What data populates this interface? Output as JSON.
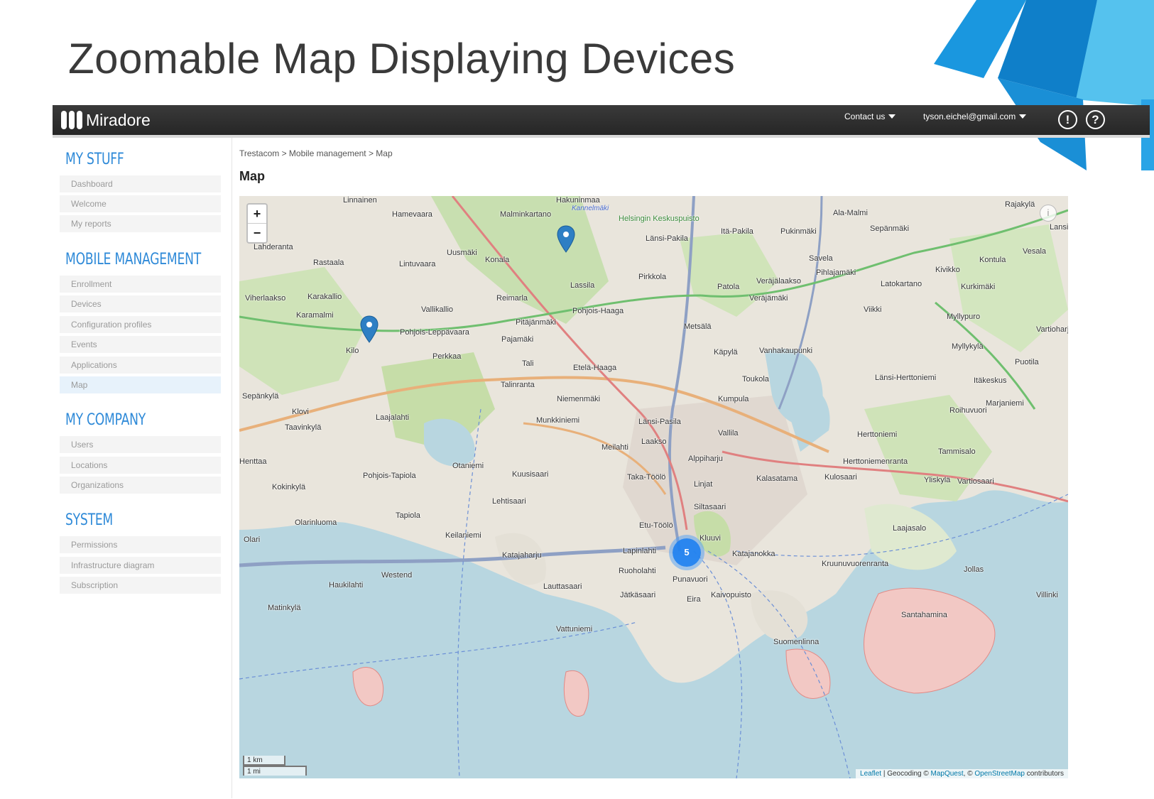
{
  "slide": {
    "title": "Zoomable Map Displaying Devices"
  },
  "topbar": {
    "logo_text": "Miradore",
    "contact_label": "Contact us",
    "user_email": "tyson.eichel@gmail.com",
    "alert_icon": "exclamation-circle-icon",
    "help_icon": "question-circle-icon"
  },
  "sidebar": {
    "sections": [
      {
        "title": "MY STUFF",
        "items": [
          "Dashboard",
          "Welcome",
          "My reports"
        ]
      },
      {
        "title": "MOBILE MANAGEMENT",
        "items": [
          "Enrollment",
          "Devices",
          "Configuration profiles",
          "Events",
          "Applications",
          "Map"
        ]
      },
      {
        "title": "MY COMPANY",
        "items": [
          "Users",
          "Locations",
          "Organizations"
        ]
      },
      {
        "title": "SYSTEM",
        "items": [
          "Permissions",
          "Infrastructure diagram",
          "Subscription"
        ]
      }
    ],
    "active_item": "Map"
  },
  "main": {
    "breadcrumb": "Trestacom > Mobile management > Map",
    "title": "Map"
  },
  "map": {
    "zoom_in": "+",
    "zoom_out": "−",
    "cluster_count": "5",
    "scale_km": "1 km",
    "scale_mi": "1 mi",
    "attribution": {
      "leaflet": "Leaflet",
      "geocoding": " | Geocoding © ",
      "mapquest": "MapQuest",
      "osm_prefix": ", © ",
      "osm": "OpenStreetMap",
      "suffix": " contributors"
    },
    "places": [
      "Linnainen",
      "Hakuninmaa",
      "Hamevaara",
      "Malminkartano",
      "Kannelmäki",
      "Ala-Malmi",
      "Rajakylä",
      "Helsingin Keskuspuisto",
      "Itä-Pakila",
      "Pukinmäki",
      "Sepänmäki",
      "Lansi",
      "Lahderanta",
      "Länsi-Pakila",
      "Vesala",
      "Uusmäki",
      "Rastaala",
      "Lintuvaara",
      "Konala",
      "Savela",
      "Kontula",
      "Pihlajamäki",
      "Pirkkola",
      "Kivikko",
      "Viherlaakso",
      "Karakallio",
      "Lassila",
      "Latokartano",
      "Patola",
      "Veräjälaakso",
      "Kurkimäki",
      "Reimarla",
      "Veräjämäki",
      "Karamalmi",
      "Vallikallio",
      "Pohjois-Haaga",
      "Viikki",
      "Myllypuro",
      "Pitäjänmäki",
      "Metsälä",
      "Vartioharju",
      "Pohjois-Leppävaara",
      "Pajamäki",
      "Käpylä",
      "Vanhakaupunki",
      "Myllykylä",
      "Kilo",
      "Perkkaa",
      "Tali",
      "Etelä-Haaga",
      "Puotila",
      "Toukola",
      "Länsi-Herttoniemi",
      "Itäkeskus",
      "Talinranta",
      "Niemenmäki",
      "Sepänkylä",
      "Kumpula",
      "Marjaniemi",
      "Klovi",
      "Laajalahti",
      "Munkkiniemi",
      "Roihuvuori",
      "Taavinkylä",
      "Länsi-Pasila",
      "Vallila",
      "Herttoniemi",
      "Laakso",
      "Meilahti",
      "Tammisalo",
      "Henttaa",
      "Otaniemi",
      "Alppiharju",
      "Herttoniemenranta",
      "Pohjois-Tapiola",
      "Kuusisaari",
      "Taka-Töölö",
      "Kalasatama",
      "Kulosaari",
      "Yliskylä",
      "Vartiosaari",
      "Kokinkylä",
      "Linjat",
      "Lehtisaari",
      "Tapiola",
      "Siltasaari",
      "Laajasalo",
      "Olarinluoma",
      "Etu-Töölö",
      "Keilaniemi",
      "Kluuvi",
      "Olari",
      "Lapinlahti",
      "Katajaharju",
      "Katajanokka",
      "Kruunuvuorenranta",
      "Westend",
      "Ruoholahti",
      "Jollas",
      "Haukilahti",
      "Punavuori",
      "Lauttasaari",
      "Jätkäsaari",
      "Kaivopuisto",
      "Eira",
      "Matinkylä",
      "Santahamina",
      "Vattuniemi",
      "Suomenlinna",
      "Villinki"
    ]
  }
}
